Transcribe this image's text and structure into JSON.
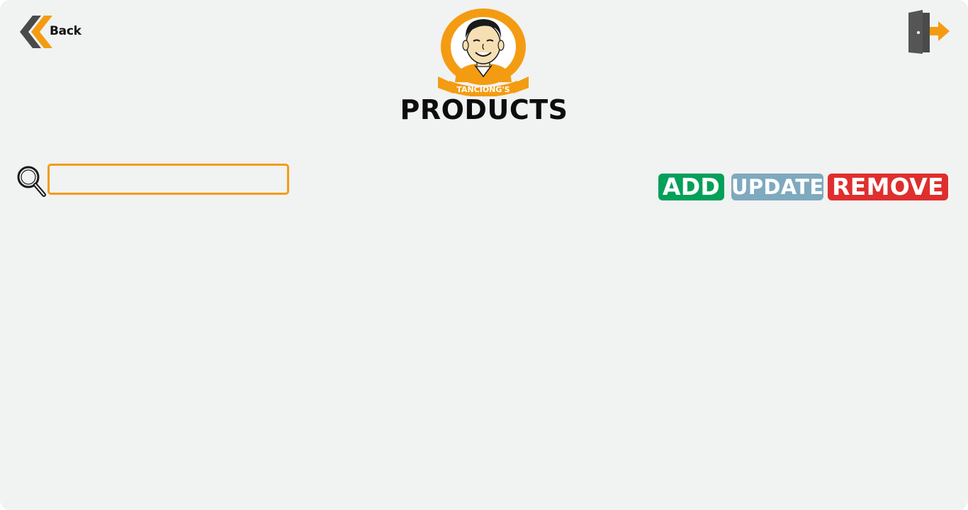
{
  "header": {
    "back_label": "Back",
    "title": "PRODUCTS",
    "logo_text": "TANCIONG'S",
    "logout_icon": "logout-door-icon"
  },
  "search": {
    "value": "",
    "placeholder": "",
    "icon": "search-icon"
  },
  "actions": {
    "add_label": "ADD",
    "update_label": "UPDATE",
    "remove_label": "REMOVE"
  },
  "colors": {
    "background": "#f1f2f2",
    "accent_orange": "#f39c12",
    "add_green": "#03a05a",
    "update_blue": "#7fa9bf",
    "remove_red": "#de2f2e",
    "icon_dark": "#4a4a4a"
  }
}
